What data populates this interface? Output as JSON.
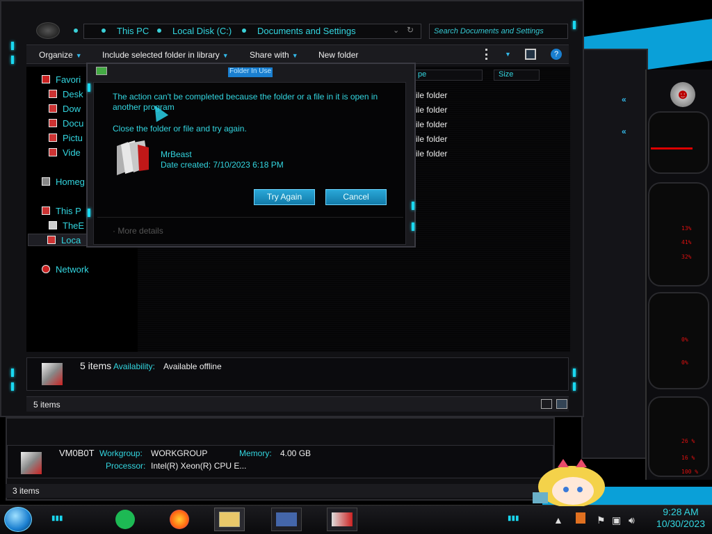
{
  "explorer": {
    "breadcrumbs": [
      "This PC",
      "Local Disk (C:)",
      "Documents and Settings"
    ],
    "search_placeholder": "Search Documents and Settings",
    "toolbar": {
      "organize": "Organize",
      "include": "Include selected folder in library",
      "share": "Share with",
      "new_folder": "New folder"
    },
    "nav": {
      "favorites": "Favori",
      "desktop": "Desk",
      "downloads": "Dow",
      "documents": "Docu",
      "pictures": "Pictu",
      "videos": "Vide",
      "homegroup": "Homeg",
      "this_pc": "This P",
      "the": "TheE",
      "local": "Loca",
      "network": "Network"
    },
    "columns": {
      "type": "pe",
      "size": "Size"
    },
    "rows": [
      "ile folder",
      "ile folder",
      "ile folder",
      "ile folder",
      "ile folder"
    ],
    "details": {
      "count": "5 items",
      "availability_label": "Availability:",
      "availability_value": "Available offline"
    },
    "status": "5 items"
  },
  "dialog": {
    "title": "Folder In Use",
    "message": "The action can't be completed because the folder or a file in it is open in another program",
    "sub": "Close the folder or file and try again.",
    "item_name": "MrBeast",
    "item_date": "Date created: 7/10/2023 6:18 PM",
    "try_again": "Try Again",
    "cancel": "Cancel",
    "more_details": "More details"
  },
  "back_window": {
    "computer_name": "VM0B0T",
    "workgroup_label": "Workgroup:",
    "workgroup_value": "WORKGROUP",
    "memory_label": "Memory:",
    "memory_value": "4.00 GB",
    "processor_label": "Processor:",
    "processor_value": "Intel(R) Xeon(R) CPU E...",
    "status": "3 items"
  },
  "gadget": {
    "values": [
      "13%",
      "41%",
      "32%",
      "0%",
      "0%",
      "26 %",
      "16 %",
      "100 %"
    ]
  },
  "taskbar": {
    "time": "9:28 AM",
    "date": "10/30/2023"
  },
  "colors": {
    "accent": "#33d6e0",
    "button": "#1a8fc8",
    "gadget_red": "#e01010"
  }
}
